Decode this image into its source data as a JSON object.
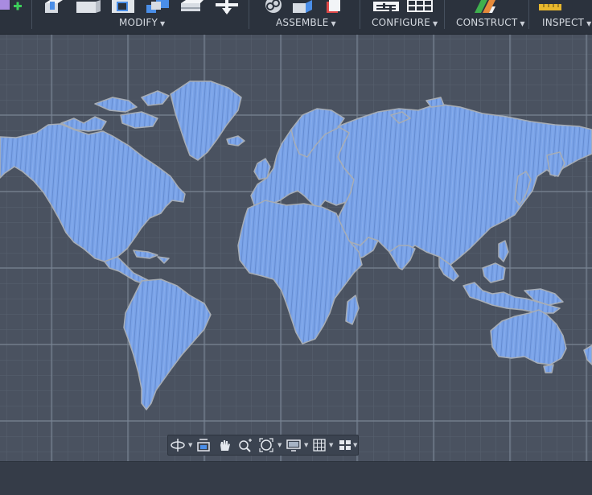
{
  "toolbar": {
    "groups": [
      {
        "label": "MODIFY"
      },
      {
        "label": "ASSEMBLE"
      },
      {
        "label": "CONFIGURE"
      },
      {
        "label": "CONSTRUCT"
      },
      {
        "label": "INSPECT"
      }
    ]
  },
  "icons": {
    "new_component": "new-component-icon",
    "press_pull": "press-pull-icon",
    "fillet": "fillet-icon",
    "shell": "shell-icon",
    "combine": "combine-icon",
    "move": "move-icon",
    "joint": "joint-icon",
    "as_built_joint": "as-built-joint-icon",
    "rigid_group": "rigid-group-icon",
    "configure_parameters": "configure-parameters-icon",
    "configure_table": "configure-table-icon",
    "offset_plane": "offset-plane-icon",
    "measure": "measure-icon"
  },
  "navbar": {
    "items": [
      "orbit",
      "look-at",
      "pan",
      "zoom",
      "fit",
      "display-settings",
      "grid-and-snaps",
      "viewports"
    ]
  },
  "colors": {
    "toolbar_bg": "#2b323d",
    "canvas_bg": "#4a5260",
    "grid_minor": "#586171",
    "grid_major": "#75808f",
    "body_fill": "#7aa3e8",
    "body_edge": "#9aa0a8",
    "statusbar_bg": "#353c48"
  }
}
